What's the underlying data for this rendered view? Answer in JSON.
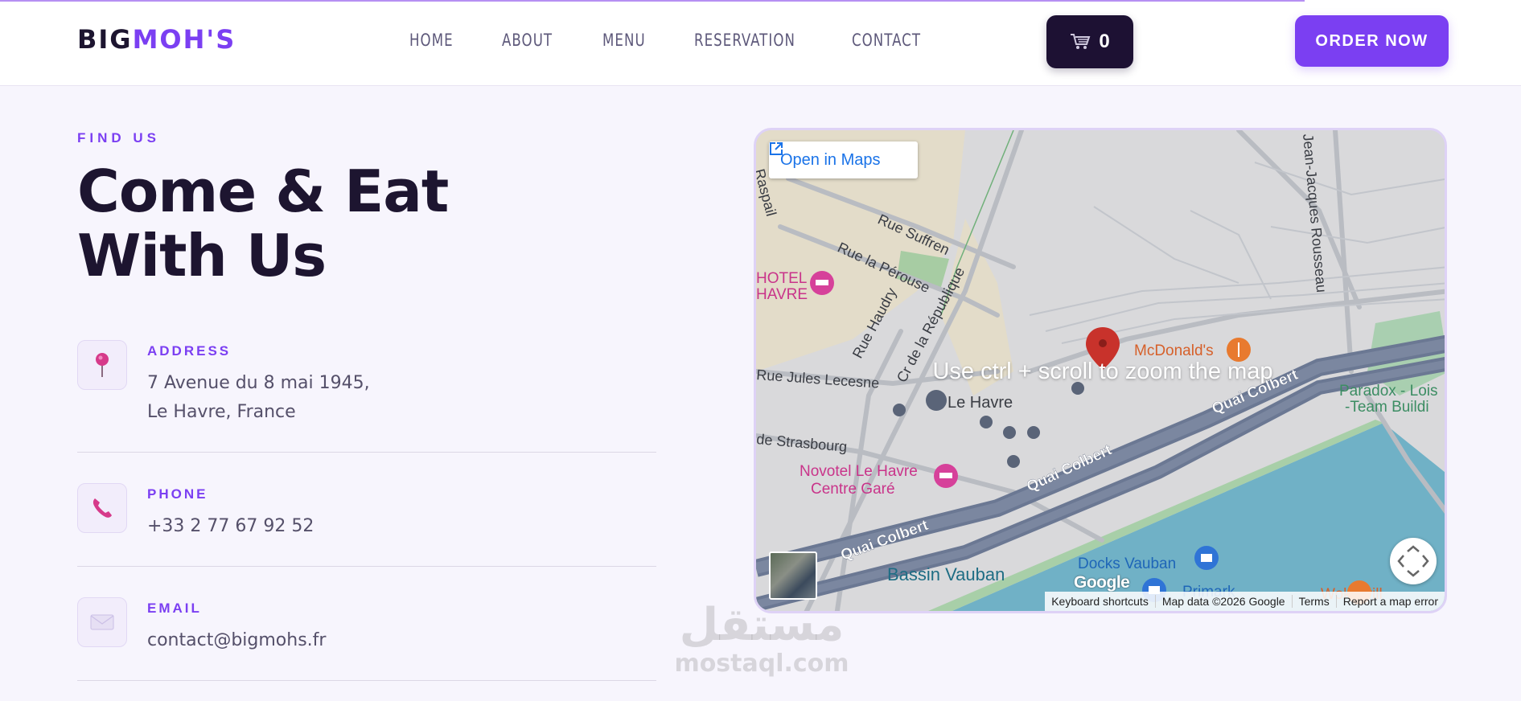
{
  "header": {
    "logo_part1": "BIG",
    "logo_part2": "MOH'S",
    "nav": [
      "HOME",
      "ABOUT",
      "MENU",
      "RESERVATION",
      "CONTACT"
    ],
    "cart_count": "0",
    "order_label": "ORDER NOW"
  },
  "hero": {
    "eyebrow": "FIND US",
    "title_line1": "Come & Eat",
    "title_line2": "With Us"
  },
  "contact": [
    {
      "label": "ADDRESS",
      "lines": [
        "7 Avenue du 8 mai 1945,",
        "Le Havre, France"
      ],
      "icon": "pin-icon"
    },
    {
      "label": "PHONE",
      "lines": [
        "+33 2 77 67 92 52"
      ],
      "icon": "phone-icon"
    },
    {
      "label": "EMAIL",
      "lines": [
        "contact@bigmohs.fr"
      ],
      "icon": "envelope-icon"
    }
  ],
  "map": {
    "open_label": "Open in Maps",
    "zoom_hint": "Use ctrl + scroll to zoom the map",
    "google": "Google",
    "attribution": [
      "Keyboard shortcuts",
      "Map data ©2026 Google",
      "Terms",
      "Report a map error"
    ],
    "labels": {
      "rue_suffren": "Rue Suffren",
      "rue_la_perouse": "Rue la Pérouse",
      "rue_haudry": "Rue Haudry",
      "cours_republique": "Cr de la République",
      "rue_jules_lecesne": "Rue Jules Lecesne",
      "de_strasbourg": "de Strasbourg",
      "le_havre": "Le Havre",
      "mcdonalds": "McDonald's",
      "quai_colbert": "Quai Colbert",
      "paradox_1": "Paradox - Lois",
      "paradox_2": "-Team Buildi",
      "novotel_1": "Novotel Le Havre",
      "novotel_2": "Centre Garé",
      "bassin_vauban": "Bassin Vauban",
      "docks_vauban": "Docks Vauban",
      "primark": "Primark",
      "wok_grill": "Wok Grill",
      "hotel_1": "HOTEL",
      "hotel_2": "HAVRE",
      "jean_jacques": "Jean-Jacques Rousseau",
      "raspail": "Raspail"
    }
  },
  "watermark": {
    "arabic": "مستقل",
    "latin": "mostaql.com"
  },
  "colors": {
    "accent": "#7b3ff2",
    "dark": "#1d1530",
    "background": "#f7f5fd"
  }
}
